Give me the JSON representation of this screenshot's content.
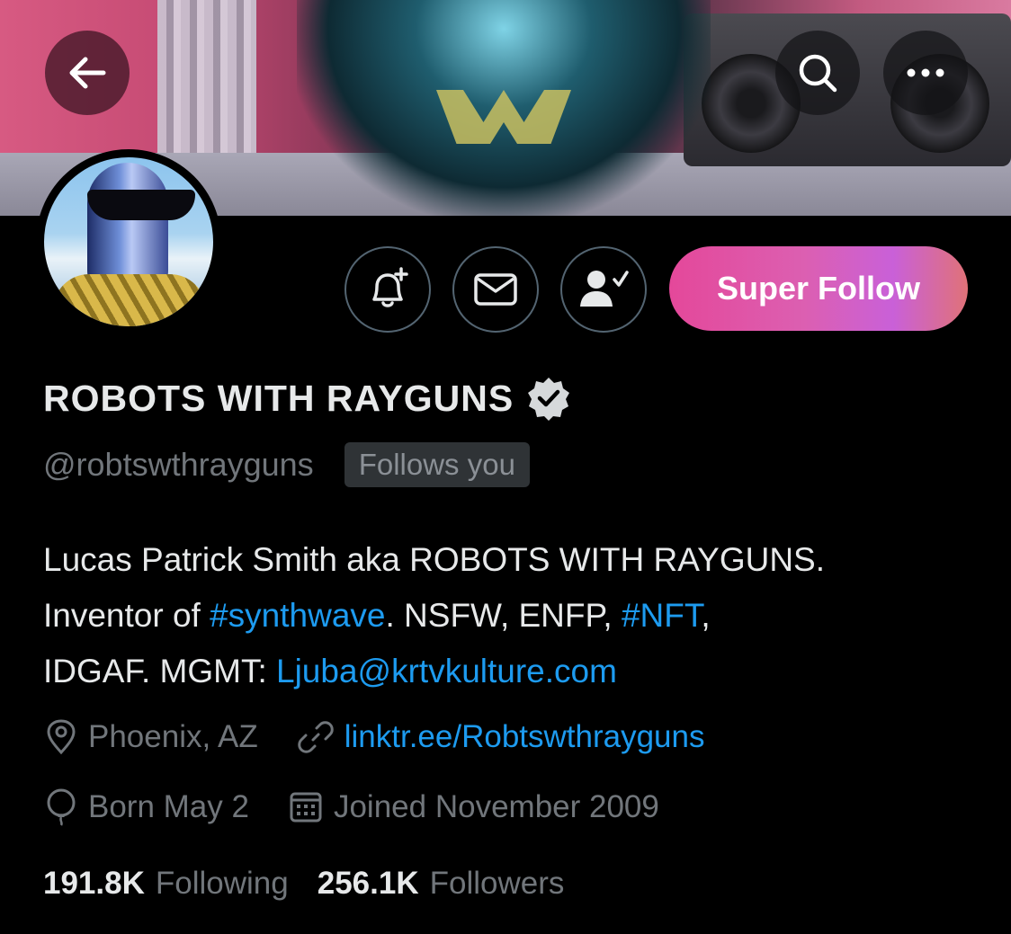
{
  "header": {
    "back_icon": "arrow-left-icon",
    "search_icon": "search-icon",
    "more_icon": "more-horizontal-icon"
  },
  "actions": {
    "notify_icon": "bell-plus-icon",
    "message_icon": "envelope-icon",
    "following_icon": "person-check-icon",
    "super_follow_label": "Super Follow"
  },
  "profile": {
    "display_name": "ROBOTS WITH RAYGUNS",
    "verified_icon": "verified-badge-icon",
    "handle": "@robtswthrayguns",
    "follows_you": "Follows you",
    "bio": {
      "line1": "Lucas Patrick Smith aka ROBOTS WITH RAYGUNS.",
      "line2_pre": "Inventor of ",
      "hashtag1": "#synthwave",
      "line2_mid": ". NSFW, ENFP, ",
      "hashtag2": "#NFT",
      "line2_post": ",",
      "line3_pre": "IDGAF. MGMT: ",
      "email": "Ljuba@krtvkulture.com"
    },
    "location": "Phoenix, AZ",
    "website": "linktr.ee/Robtswthrayguns",
    "birthday": "Born May 2",
    "joined": "Joined November 2009"
  },
  "stats": {
    "following_count": "191.8K",
    "following_label": "Following",
    "followers_count": "256.1K",
    "followers_label": "Followers"
  },
  "colors": {
    "accent_link": "#1d9bf0",
    "muted_text": "#71767b",
    "background": "#000000"
  }
}
